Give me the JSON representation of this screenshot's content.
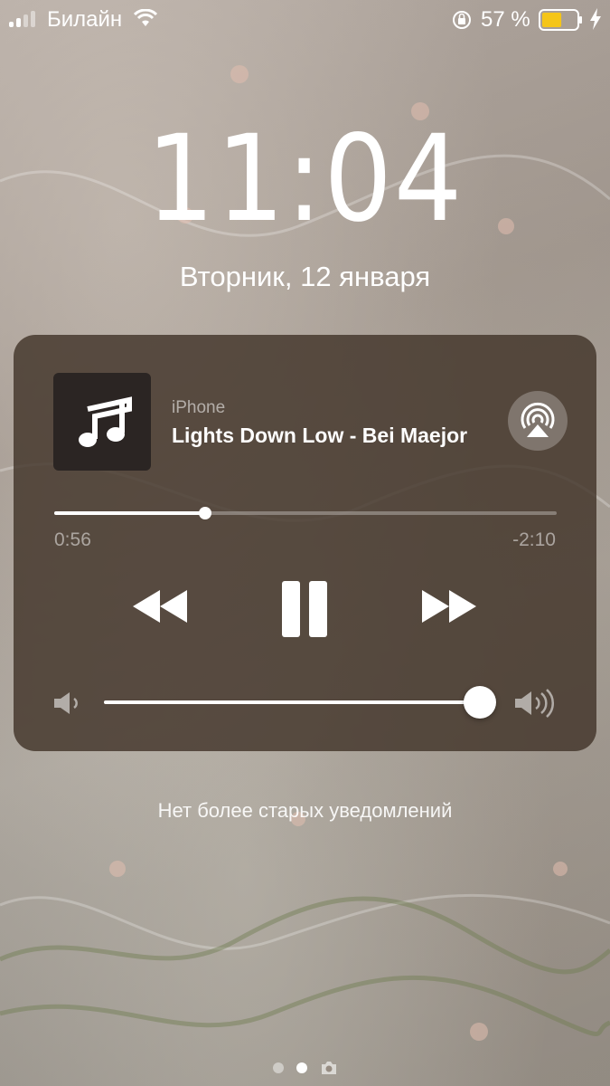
{
  "status_bar": {
    "carrier": "Билайн",
    "battery_percent": "57 %",
    "battery_level": 0.57,
    "battery_color": "#f5c518",
    "icons": [
      "signal-icon",
      "wifi-icon",
      "rotation-lock-icon",
      "battery-icon",
      "charging-icon"
    ]
  },
  "lock_screen": {
    "time": "11:04",
    "date": "Вторник, 12 января",
    "no_notifications": "Нет более старых уведомлений"
  },
  "player": {
    "source": "iPhone",
    "title": "Lights Down Low - Bei Maejor",
    "elapsed": "0:56",
    "remaining": "-2:10",
    "progress": 0.3,
    "volume": 1.0,
    "icons": [
      "music-note-icon",
      "airplay-icon",
      "rewind-icon",
      "pause-icon",
      "fast-forward-icon",
      "volume-low-icon",
      "volume-high-icon"
    ]
  },
  "page_indicator": {
    "pages": 2,
    "active": 1,
    "extra_icon": "camera-icon"
  }
}
